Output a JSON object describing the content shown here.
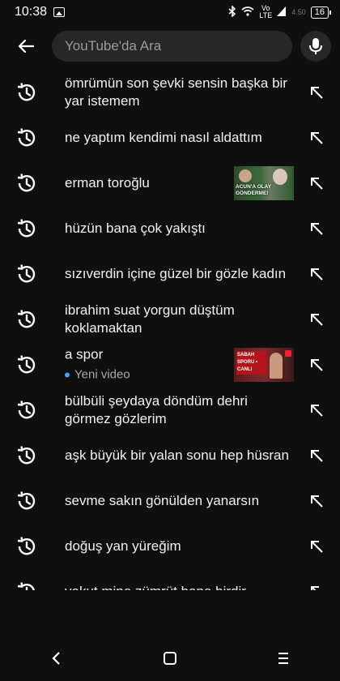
{
  "status": {
    "time": "10:38",
    "network_top": "Vo",
    "network_bottom": "LTE",
    "data_rate": "4.50",
    "battery": "16"
  },
  "search": {
    "placeholder": "YouTube'da Ara"
  },
  "history": [
    {
      "text": "ömrümün son şevki sensin başka bir yar istemem"
    },
    {
      "text": "ne yaptım kendimi nasıl aldattım"
    },
    {
      "text": "erman toroğlu",
      "thumb_caption": "ACUN'A OLAY GÖNDERME!"
    },
    {
      "text": "hüzün bana çok yakıştı"
    },
    {
      "text": "sızıverdin içine güzel bir gözle kadın"
    },
    {
      "text": "ibrahim suat yorgun düştüm koklamaktan"
    },
    {
      "text": "a spor",
      "sub": "Yeni video",
      "thumb_caption": "SABAH SPORU • CANLI"
    },
    {
      "text": "bülbüli şeydaya döndüm dehri görmez gözlerim"
    },
    {
      "text": "aşk büyük bir yalan sonu hep hüsran"
    },
    {
      "text": "sevme sakın gönülden yanarsın"
    },
    {
      "text": "doğuş yan yüreğim"
    },
    {
      "text": "yakut mine zümrüt bana birdir"
    }
  ],
  "colors": {
    "background": "#0f0f0f",
    "search_bg": "#272727",
    "new_video_dot": "#3ea6ff"
  }
}
